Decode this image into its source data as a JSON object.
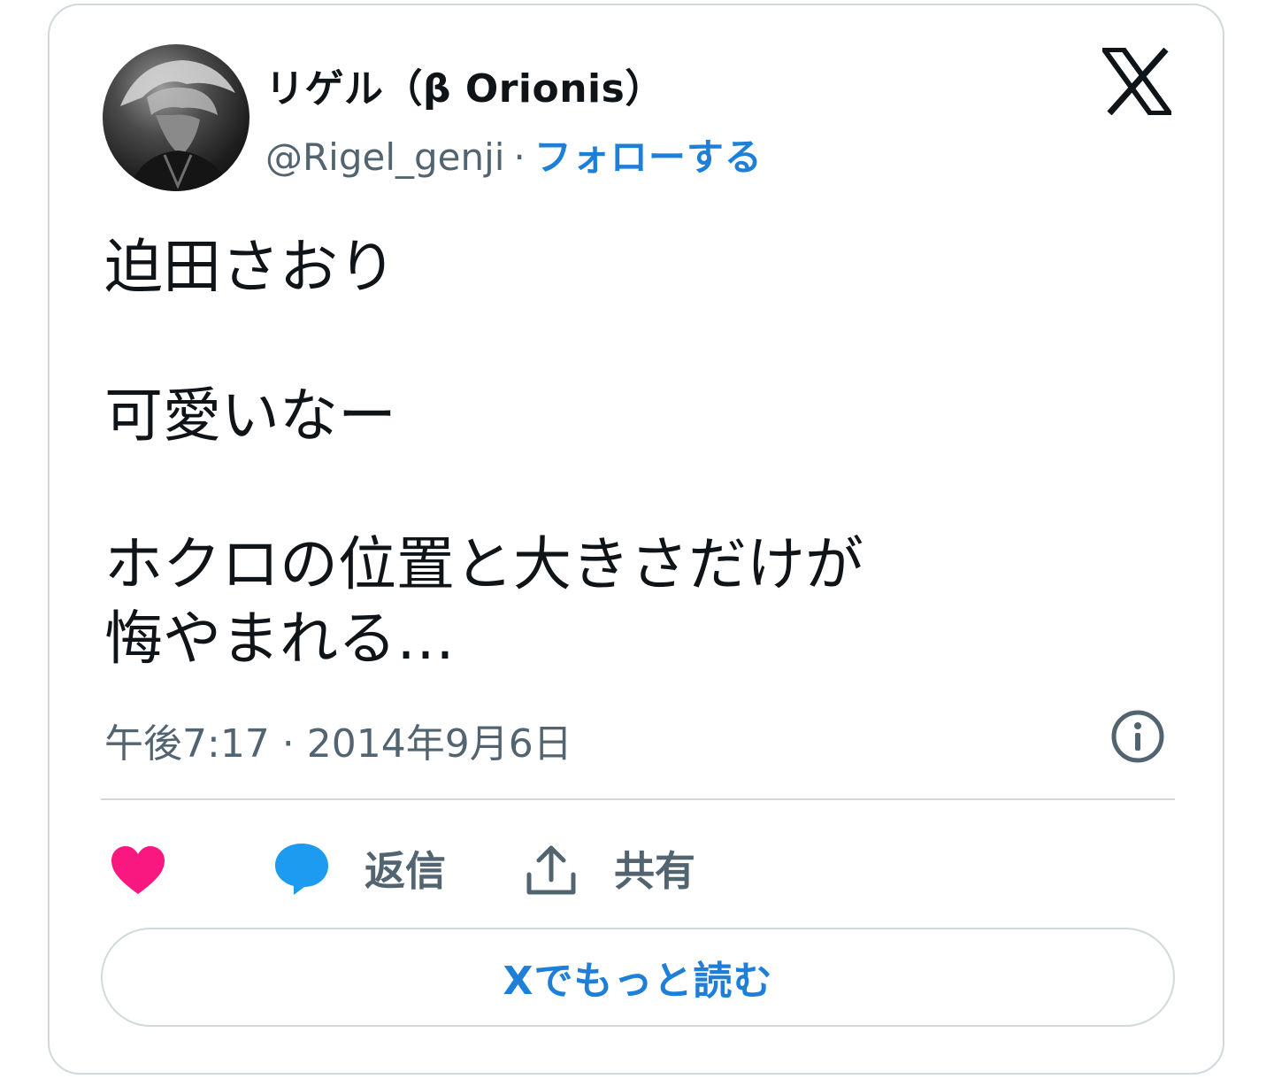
{
  "author": {
    "display_name": "リゲル（β Orionis）",
    "handle": "@Rigel_genji",
    "separator": "·",
    "follow_label": "フォローする"
  },
  "tweet": {
    "text": "迫田さおり\n\n可愛いなー\n\nホクロの位置と大きさだけが\n悔やまれる…",
    "timestamp": "午後7:17 · 2014年9月6日"
  },
  "actions": {
    "reply_label": "返信",
    "share_label": "共有"
  },
  "footer": {
    "read_more_label": "Xでもっと読む"
  },
  "colors": {
    "like": "#f91880",
    "reply": "#1d9bf0",
    "link": "#1d7fd8",
    "muted": "#536471",
    "border": "#cfd9de"
  },
  "icons": [
    "x-logo-icon",
    "info-icon",
    "heart-icon",
    "reply-bubble-icon",
    "share-icon"
  ]
}
